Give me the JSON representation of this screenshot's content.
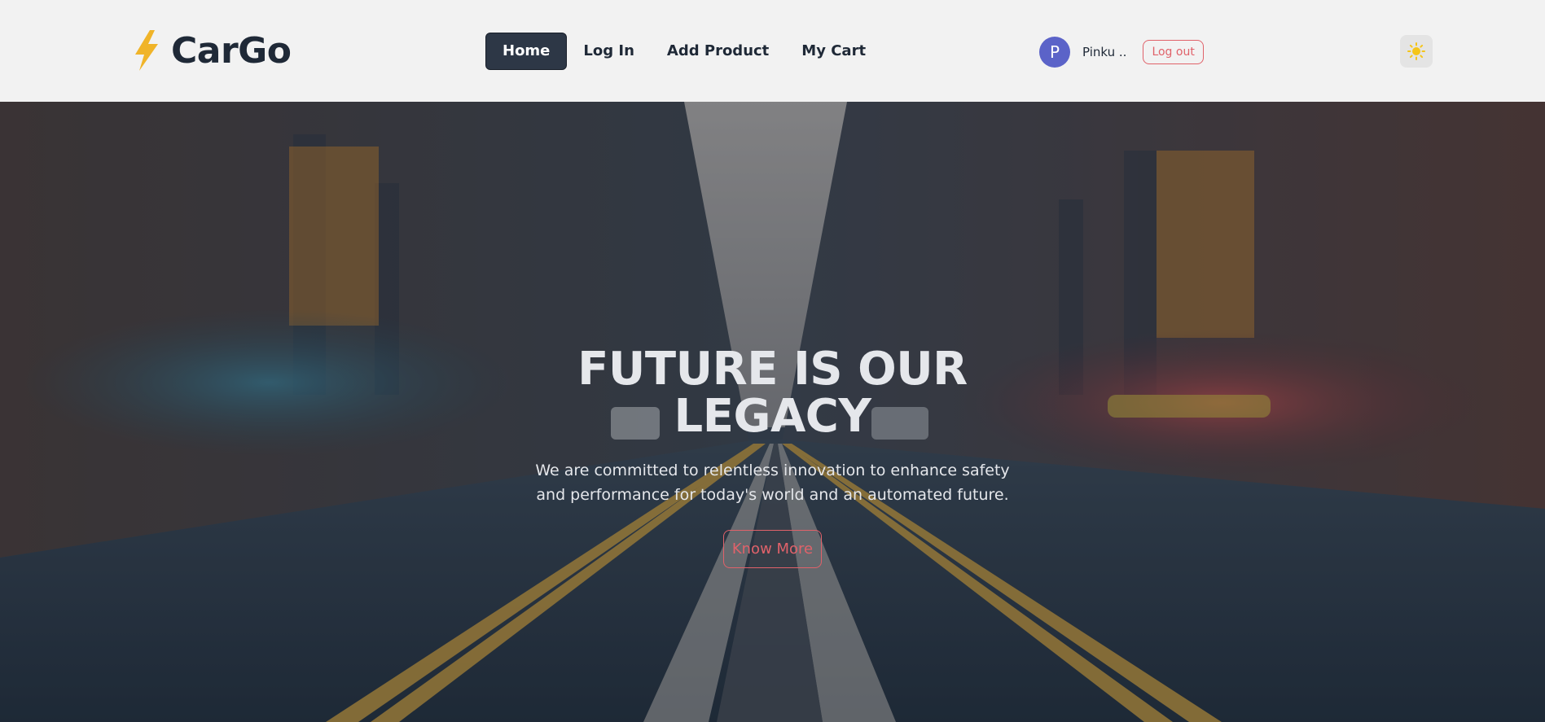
{
  "brand": {
    "name": "CarGo",
    "icon": "lightning-bolt-icon",
    "icon_color": "#f0b429"
  },
  "nav": {
    "links": [
      {
        "label": "Home",
        "active": true
      },
      {
        "label": "Log In",
        "active": false
      },
      {
        "label": "Add Product",
        "active": false
      },
      {
        "label": "My Cart",
        "active": false
      }
    ]
  },
  "user": {
    "avatar_letter": "P",
    "name": "Pinku ..",
    "logout_label": "Log out",
    "avatar_color": "#5b63c8"
  },
  "theme_toggle": {
    "icon": "sun-icon",
    "color": "#f5c518"
  },
  "hero": {
    "title": "FUTURE IS OUR LEGACY",
    "subtitle": "We are committed to relentless innovation to enhance safety and performance for today's world and an automated future.",
    "cta_label": "Know More",
    "cta_color": "#e0626a"
  }
}
